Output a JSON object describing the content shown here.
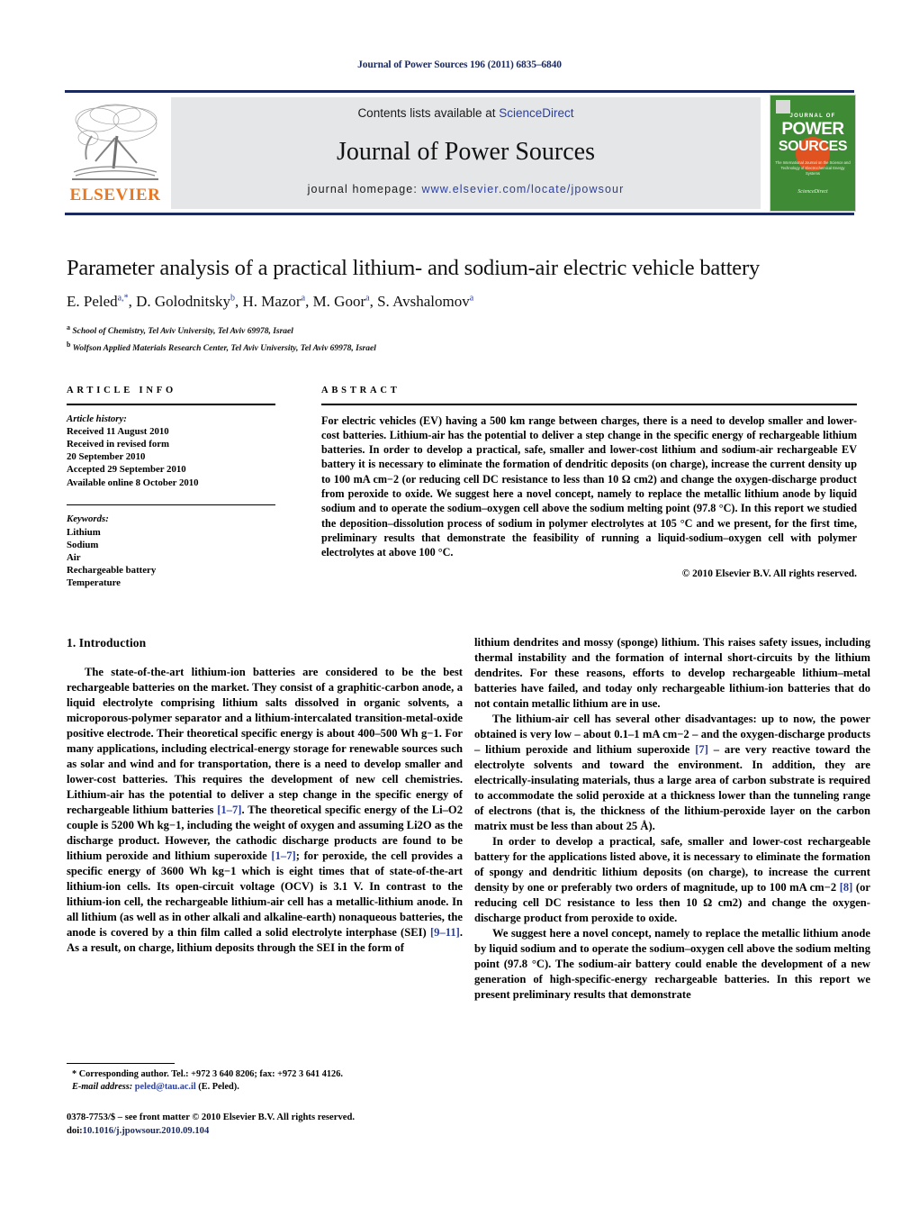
{
  "running_head": "Journal of Power Sources 196 (2011) 6835–6840",
  "masthead": {
    "publisher_name": "ELSEVIER",
    "contents_prefix": "Contents lists available at ",
    "contents_link": "ScienceDirect",
    "journal_title": "Journal of Power Sources",
    "homepage_prefix": "journal homepage: ",
    "homepage_link": "www.elsevier.com/locate/jpowsour",
    "cover": {
      "line1": "JOURNAL OF",
      "line2": "POWER",
      "line3": "SOURCES",
      "blurb": "The International Journal on the Science and Technology of Electrochemical Energy Systems",
      "footer": "ScienceDirect",
      "bg_color": "#3f8a34",
      "circle_color": "#e0521f"
    },
    "band_color": "#e4e6e8",
    "rule_color": "#1b2a5e",
    "link_color": "#2b3f9e",
    "elsevier_orange": "#e87722"
  },
  "article": {
    "title": "Parameter analysis of a practical lithium- and sodium-air electric vehicle battery",
    "authors": "E. Peled a,*, D. Golodnitsky b, H. Mazor a, M. Goor a, S. Avshalomov a",
    "affiliation_a": "School of Chemistry, Tel Aviv University, Tel Aviv 69978, Israel",
    "affiliation_b": "Wolfson Applied Materials Research Center, Tel Aviv University, Tel Aviv 69978, Israel"
  },
  "info": {
    "heading": "ARTICLE INFO",
    "history_label": "Article history:",
    "history": [
      "Received 11 August 2010",
      "Received in revised form",
      "20 September 2010",
      "Accepted 29 September 2010",
      "Available online 8 October 2010"
    ],
    "keywords_label": "Keywords:",
    "keywords": [
      "Lithium",
      "Sodium",
      "Air",
      "Rechargeable battery",
      "Temperature"
    ]
  },
  "abstract": {
    "heading": "ABSTRACT",
    "text": "For electric vehicles (EV) having a 500 km range between charges, there is a need to develop smaller and lower-cost batteries. Lithium-air has the potential to deliver a step change in the specific energy of rechargeable lithium batteries. In order to develop a practical, safe, smaller and lower-cost lithium and sodium-air rechargeable EV battery it is necessary to eliminate the formation of dendritic deposits (on charge), increase the current density up to 100 mA cm−2 (or reducing cell DC resistance to less than 10 Ω cm2) and change the oxygen-discharge product from peroxide to oxide. We suggest here a novel concept, namely to replace the metallic lithium anode by liquid sodium and to operate the sodium–oxygen cell above the sodium melting point (97.8 °C). In this report we studied the deposition–dissolution process of sodium in polymer electrolytes at 105 °C and we present, for the first time, preliminary results that demonstrate the feasibility of running a liquid-sodium–oxygen cell with polymer electrolytes at above 100 °C.",
    "copyright": "© 2010 Elsevier B.V. All rights reserved."
  },
  "body": {
    "section_heading": "1. Introduction",
    "left_p1": "The state-of-the-art lithium-ion batteries are considered to be the best rechargeable batteries on the market. They consist of a graphitic-carbon anode, a liquid electrolyte comprising lithium salts dissolved in organic solvents, a microporous-polymer separator and a lithium-intercalated transition-metal-oxide positive electrode. Their theoretical specific energy is about 400–500 Wh g−1. For many applications, including electrical-energy storage for renewable sources such as solar and wind and for transportation, there is a need to develop smaller and lower-cost batteries. This requires the development of new cell chemistries. Lithium-air has the potential to deliver a step change in the specific energy of rechargeable lithium batteries ",
    "left_ref1": "[1–7]",
    "left_p1b": ". The theoretical specific energy of the Li–O2 couple is 5200 Wh kg−1, including the weight of oxygen and assuming Li2O as the discharge product. However, the cathodic discharge products are found to be lithium peroxide and lithium superoxide ",
    "left_ref2": "[1–7]",
    "left_p1c": "; for peroxide, the cell provides a specific energy of 3600 Wh kg−1 which is eight times that of state-of-the-art lithium-ion cells. Its open-circuit voltage (OCV) is 3.1 V. In contrast to the lithium-ion cell, the rechargeable lithium-air cell has a metallic-lithium anode. In all lithium (as well as in other alkali and alkaline-earth) nonaqueous batteries, the anode is covered by a thin film called a solid electrolyte interphase (SEI) ",
    "left_ref3": "[9–11]",
    "left_p1d": ". As a result, on charge, lithium deposits through the SEI in the form of",
    "right_p1": "lithium dendrites and mossy (sponge) lithium. This raises safety issues, including thermal instability and the formation of internal short-circuits by the lithium dendrites. For these reasons, efforts to develop rechargeable lithium–metal batteries have failed, and today only rechargeable lithium-ion batteries that do not contain metallic lithium are in use.",
    "right_p2a": "The lithium-air cell has several other disadvantages: up to now, the power obtained is very low – about 0.1–1 mA cm−2 – and the oxygen-discharge products – lithium peroxide and lithium superoxide ",
    "right_ref1": "[7]",
    "right_p2b": " – are very reactive toward the electrolyte solvents and toward the environment. In addition, they are electrically-insulating materials, thus a large area of carbon substrate is required to accommodate the solid peroxide at a thickness lower than the tunneling range of electrons (that is, the thickness of the lithium-peroxide layer on the carbon matrix must be less than about 25 Å).",
    "right_p3a": "In order to develop a practical, safe, smaller and lower-cost rechargeable battery for the applications listed above, it is necessary to eliminate the formation of spongy and dendritic lithium deposits (on charge), to increase the current density by one or preferably two orders of magnitude, up to 100 mA cm−2 ",
    "right_ref2": "[8]",
    "right_p3b": " (or reducing cell DC resistance to less then 10 Ω cm2) and change the oxygen-discharge product from peroxide to oxide.",
    "right_p4": "We suggest here a novel concept, namely to replace the metallic lithium anode by liquid sodium and to operate the sodium–oxygen cell above the sodium melting point (97.8 °C). The sodium-air battery could enable the development of a new generation of high-specific-energy rechargeable batteries. In this report we present preliminary results that demonstrate"
  },
  "footer": {
    "corresponding": "* Corresponding author. Tel.: +972 3 640 8206; fax: +972 3 641 4126.",
    "email_label": "E-mail address:",
    "email": "peled@tau.ac.il",
    "email_suffix": " (E. Peled).",
    "issn_line": "0378-7753/$ – see front matter © 2010 Elsevier B.V. All rights reserved.",
    "doi_label": "doi:",
    "doi": "10.1016/j.jpowsour.2010.09.104"
  }
}
